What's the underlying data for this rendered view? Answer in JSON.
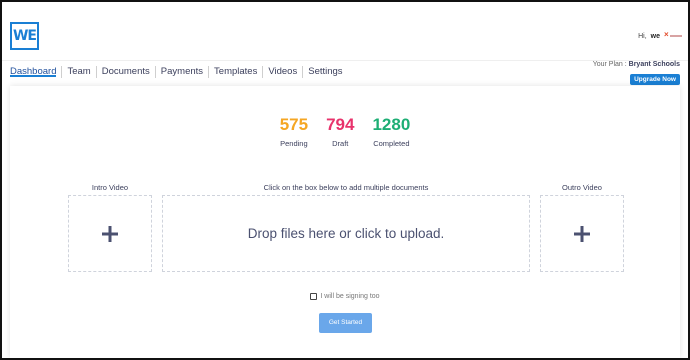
{
  "header": {
    "logo_text": "WE",
    "greeting": "Hi,",
    "user_name": "we"
  },
  "nav": {
    "tabs": [
      {
        "label": "Dashboard",
        "active": true
      },
      {
        "label": "Team",
        "active": false
      },
      {
        "label": "Documents",
        "active": false
      },
      {
        "label": "Payments",
        "active": false
      },
      {
        "label": "Templates",
        "active": false
      },
      {
        "label": "Videos",
        "active": false
      },
      {
        "label": "Settings",
        "active": false
      }
    ],
    "plan_label": "Your Plan :",
    "plan_name": "Bryant Schools",
    "upgrade_label": "Upgrade Now"
  },
  "stats": [
    {
      "value": "575",
      "label": "Pending",
      "color": "#f5a623"
    },
    {
      "value": "794",
      "label": "Draft",
      "color": "#e8336c"
    },
    {
      "value": "1280",
      "label": "Completed",
      "color": "#1dae74"
    }
  ],
  "upload": {
    "intro_label": "Intro Video",
    "documents_label": "Click on the box below to add multiple documents",
    "outro_label": "Outro Video",
    "drop_text": "Drop files here or click to upload."
  },
  "signing": {
    "checkbox_label": "I will be signing too",
    "checked": false
  },
  "get_started_label": "Get Started",
  "colors": {
    "accent": "#1a7fd4",
    "button_light": "#6aa7ea",
    "text_dark": "#3b3f5c"
  }
}
